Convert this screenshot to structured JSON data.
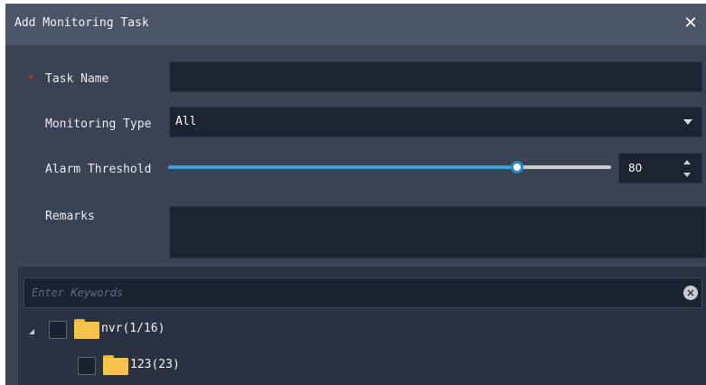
{
  "dialog": {
    "title": "Add Monitoring Task",
    "close_icon": "close-icon"
  },
  "form": {
    "task_name": {
      "label": "Task Name",
      "required_marker": "*",
      "value": ""
    },
    "monitoring_type": {
      "label": "Monitoring Type",
      "selected": "All"
    },
    "alarm_threshold": {
      "label": "Alarm Threshold",
      "value": "80",
      "level_fraction": 0.8
    },
    "remarks": {
      "label": "Remarks",
      "value": ""
    }
  },
  "tree": {
    "search_placeholder": "Enter Keywords",
    "nodes": [
      {
        "label": "nvr(1/16)",
        "expanded": true,
        "checked": false
      },
      {
        "label": "123(23)",
        "checked": false
      }
    ]
  },
  "colors": {
    "accent": "#3d9be0",
    "required": "#d9302c",
    "folder": "#f7c34a"
  }
}
